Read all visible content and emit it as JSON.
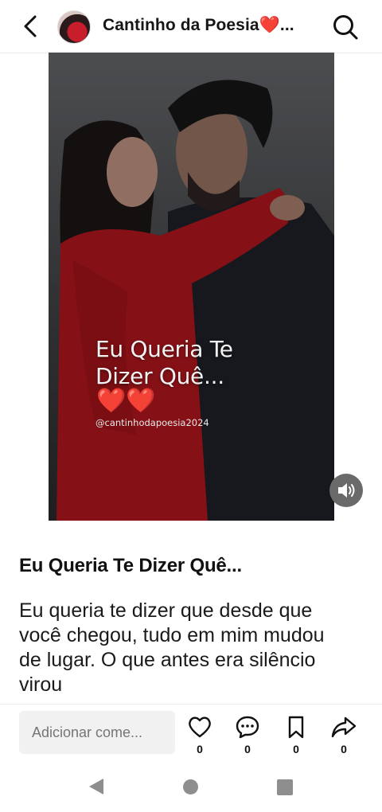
{
  "header": {
    "title": "Cantinho da Poesia❤️...",
    "back_icon": "chevron-left-icon",
    "search_icon": "search-icon"
  },
  "video": {
    "overlay_line1": "Eu Queria Te",
    "overlay_line2": "Dizer Quê...",
    "overlay_hearts": "❤️❤️",
    "overlay_handle": "@cantinhodapoesia2024",
    "sound_icon": "speaker-icon"
  },
  "post": {
    "title": "Eu Queria Te Dizer Quê...",
    "body": "Eu queria te dizer que desde que você chegou, tudo em mim mudou de lugar. O que antes era silêncio virou"
  },
  "actions": {
    "comment_placeholder": "Adicionar come...",
    "like_count": "0",
    "comment_count": "0",
    "save_count": "0",
    "share_count": "0"
  },
  "colors": {
    "accent_red": "#e2262c",
    "input_bg": "#f1f1f1",
    "nav_gray": "#8e8e8e"
  }
}
